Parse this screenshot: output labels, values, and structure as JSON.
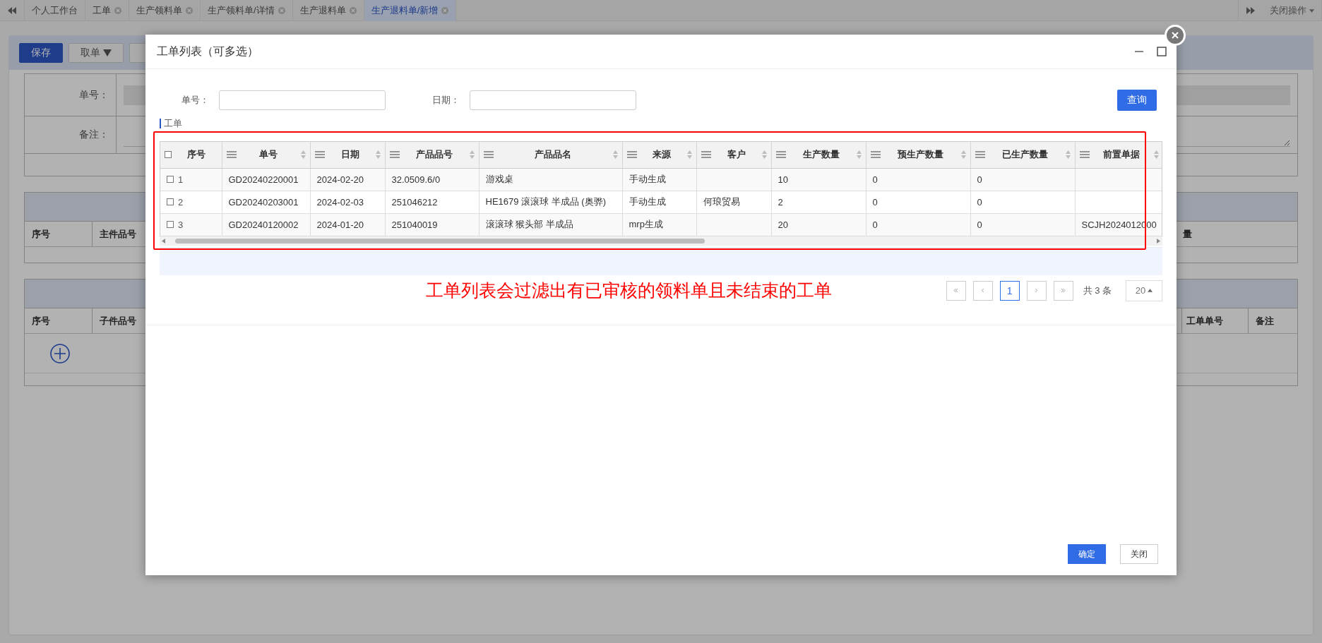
{
  "tab_bar": {
    "tabs": [
      {
        "label": "个人工作台",
        "selected": false,
        "closable": false
      },
      {
        "label": "工单",
        "selected": false,
        "closable": true
      },
      {
        "label": "生产领料单",
        "selected": false,
        "closable": true
      },
      {
        "label": "生产领料单/详情",
        "selected": false,
        "closable": true
      },
      {
        "label": "生产退料单",
        "selected": false,
        "closable": true
      },
      {
        "label": "生产退料单/新增",
        "selected": true,
        "closable": true
      }
    ],
    "close_actions": "关闭操作"
  },
  "toolbar": {
    "buttons": [
      {
        "label": "保存",
        "kind": "primary"
      },
      {
        "label": "取单",
        "kind": "dropdown"
      }
    ]
  },
  "form": {
    "fields": [
      {
        "label": "单号：",
        "kind": "input"
      },
      {
        "label": "备注：",
        "kind": "textarea"
      }
    ]
  },
  "main_table": {
    "columns": [
      "序号",
      "主件品号",
      "量"
    ]
  },
  "detail_table": {
    "columns": [
      "序号",
      "子件品号",
      "工单单号",
      "备注"
    ]
  },
  "dialog": {
    "title": "工单列表（可多选）",
    "filters": [
      {
        "label": "单号："
      },
      {
        "label": "日期："
      }
    ],
    "search_button": "查询",
    "section_title": "工单",
    "table": {
      "columns": [
        {
          "label": "序号",
          "kind": "check",
          "checked": false
        },
        {
          "label": "单号",
          "kind": "sortable"
        },
        {
          "label": "日期",
          "kind": "sortable"
        },
        {
          "label": "产品品号",
          "kind": "sortable"
        },
        {
          "label": "产品品名",
          "kind": "sortable"
        },
        {
          "label": "来源",
          "kind": "sortable"
        },
        {
          "label": "客户",
          "kind": "sortable"
        },
        {
          "label": "生产数量",
          "kind": "sortable"
        },
        {
          "label": "预生产数量",
          "kind": "sortable"
        },
        {
          "label": "已生产数量",
          "kind": "sortable"
        },
        {
          "label": "前置单据",
          "kind": "sortable"
        }
      ],
      "rows": [
        {
          "checked": false,
          "cells": [
            "1",
            "GD20240220001",
            "2024-02-20",
            "32.0509.6/0",
            "游戏桌",
            "手动生成",
            "",
            "10",
            "0",
            "0",
            ""
          ]
        },
        {
          "checked": false,
          "cells": [
            "2",
            "GD20240203001",
            "2024-02-03",
            "251046212",
            "HE1679 滚滚球 半成品 (奥骅)",
            "手动生成",
            "何琅贸易",
            "2",
            "0",
            "0",
            ""
          ]
        },
        {
          "checked": false,
          "cells": [
            "3",
            "GD20240120002",
            "2024-01-20",
            "251040019",
            "滚滚球 猴头部 半成品",
            "mrp生成",
            "",
            "20",
            "0",
            "0",
            "SCJH2024012000"
          ]
        }
      ]
    },
    "annotation": "工单列表会过滤出有已审核的领料单且未结束的工单",
    "pagination": {
      "pages": [
        {
          "label": "1",
          "selected": true
        }
      ],
      "total": "共 3 条",
      "page_size": "20"
    },
    "buttons": [
      {
        "label": "确定",
        "kind": "primary"
      },
      {
        "label": "关闭",
        "kind": "default"
      }
    ]
  }
}
